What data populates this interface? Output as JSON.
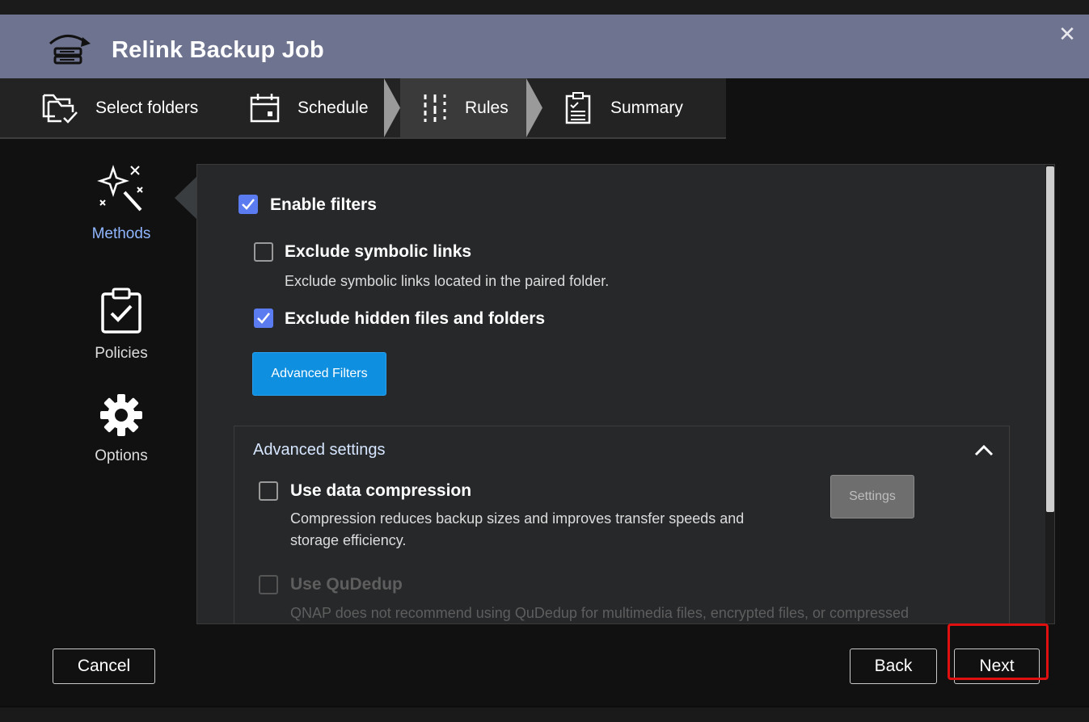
{
  "window": {
    "title": "Relink Backup Job"
  },
  "steps": [
    {
      "label": "Select folders"
    },
    {
      "label": "Schedule"
    },
    {
      "label": "Rules"
    },
    {
      "label": "Summary"
    }
  ],
  "sidenav": [
    {
      "label": "Methods"
    },
    {
      "label": "Policies"
    },
    {
      "label": "Options"
    }
  ],
  "filters": {
    "enable_label": "Enable filters",
    "symlinks_label": "Exclude symbolic links",
    "symlinks_desc": "Exclude symbolic links located in the paired folder.",
    "hidden_label": "Exclude hidden files and folders",
    "advanced_button": "Advanced Filters"
  },
  "advanced": {
    "title": "Advanced settings",
    "compression_label": "Use data compression",
    "compression_desc_1": "Compression reduces backup sizes and improves transfer speeds and",
    "compression_desc_2": "storage efficiency.",
    "settings_button": "Settings",
    "qudedup_label": "Use QuDedup",
    "qudedup_desc": "QNAP does not recommend using QuDedup for multimedia files, encrypted files, or compressed"
  },
  "footer": {
    "cancel": "Cancel",
    "back": "Back",
    "next": "Next"
  },
  "colors": {
    "titlebar": "#6e7390",
    "accent_blue": "#0e8fe0",
    "checkbox_checked": "#5b7cf0",
    "highlight_red": "#e01010"
  }
}
